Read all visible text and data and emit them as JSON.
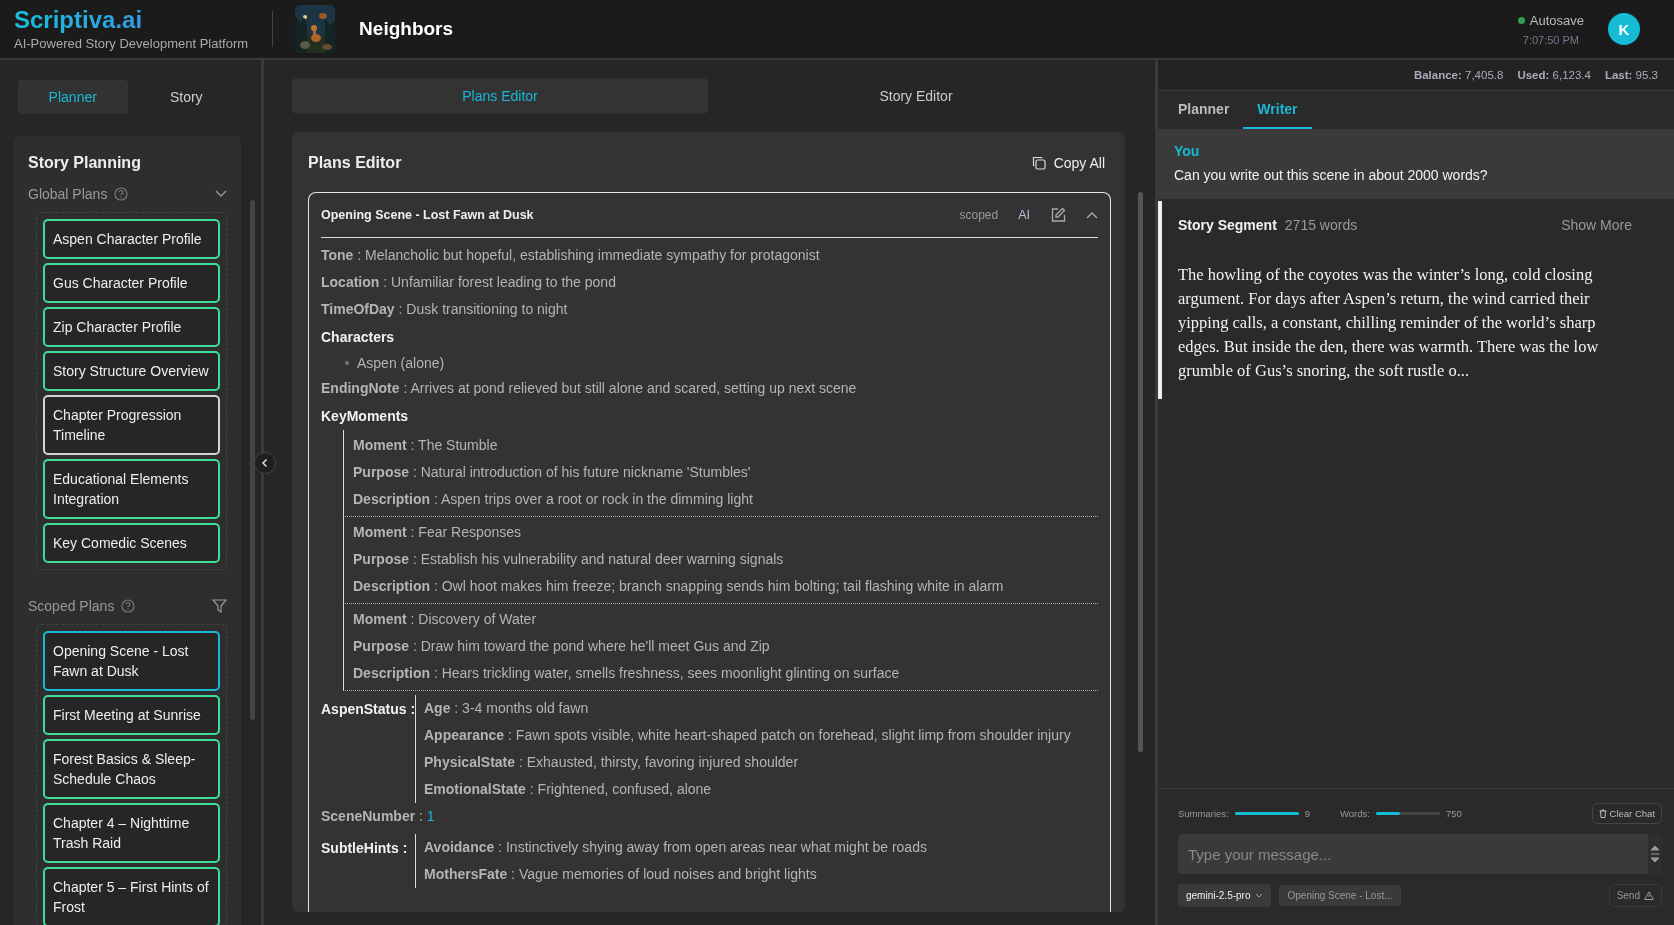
{
  "header": {
    "logo": "Scriptiva.ai",
    "tagline": "AI-Powered Story Development Platform",
    "project_title": "Neighbors",
    "autosave": {
      "label": "Autosave",
      "on": true,
      "time": "7:07:50 PM"
    },
    "avatar": "K"
  },
  "sidebar": {
    "tabs": [
      {
        "label": "Planner",
        "selected": true
      },
      {
        "label": "Story",
        "selected": false
      }
    ],
    "title": "Story Planning",
    "sections": [
      {
        "title": "Global Plans",
        "kind": "chevron",
        "items": [
          {
            "label": "Aspen Character Profile",
            "color": "#3ddc97",
            "selected": false
          },
          {
            "label": "Gus Character Profile",
            "color": "#3ddc97",
            "selected": false
          },
          {
            "label": "Zip Character Profile",
            "color": "#3ddc97",
            "selected": false
          },
          {
            "label": "Story Structure Overview",
            "color": "#3ddc97",
            "selected": false
          },
          {
            "label": "Chapter Progression Timeline",
            "color": "#d4d4d4",
            "selected": false
          },
          {
            "label": "Educational Elements Integration",
            "color": "#3ddc97",
            "selected": false
          },
          {
            "label": "Key Comedic Scenes",
            "color": "#3ddc97",
            "selected": false
          }
        ]
      },
      {
        "title": "Scoped Plans",
        "kind": "filter",
        "items": [
          {
            "label": "Opening Scene - Lost Fawn at Dusk",
            "selected": true
          },
          {
            "label": "First Meeting at Sunrise",
            "color": "#3ddc97",
            "selected": false
          },
          {
            "label": "Forest Basics & Sleep-Schedule Chaos",
            "color": "#3ddc97",
            "selected": false
          },
          {
            "label": "Chapter 4 – Nighttime Trash Raid",
            "color": "#3ddc97",
            "selected": false
          },
          {
            "label": "Chapter 5 – First Hints of Frost",
            "color": "#3ddc97",
            "selected": false
          }
        ]
      }
    ]
  },
  "editor": {
    "tabs": [
      {
        "label": "Plans Editor",
        "selected": true
      },
      {
        "label": "Story Editor",
        "selected": false
      }
    ],
    "title": "Plans Editor",
    "copy_button": "Copy All",
    "plan": {
      "title": "Opening Scene - Lost Fawn at Dusk",
      "scope": "scoped",
      "ai": "AI",
      "expanded": true,
      "fields": [
        {
          "kind": "text",
          "text": "**Tone** : Melancholic but hopeful, establishing immediate sympathy for protagonist"
        },
        {
          "kind": "text",
          "text": "**Location** : Unfamiliar forest leading to the pond"
        },
        {
          "kind": "text",
          "text": "**TimeOfDay** : Dusk transitioning to night"
        },
        {
          "kind": "list",
          "key": "Characters",
          "items": [
            "Aspen (alone)"
          ]
        },
        {
          "kind": "text",
          "text": "**EndingNote** : Arrives at pond relieved but still alone and scared, setting up next scene"
        },
        {
          "kind": "groups",
          "key": "KeyMoments",
          "groups": [
            [
              "**Moment** : The Stumble",
              "**Purpose** : Natural introduction of his future nickname 'Stumbles'",
              "**Description** : Aspen trips over a root or rock in the dimming light"
            ],
            [
              "**Moment** : Fear Responses",
              "**Purpose** : Establish his vulnerability and natural deer warning signals",
              "**Description** : Owl hoot makes him freeze; branch snapping sends him bolting; tail flashing white in alarm"
            ],
            [
              "**Moment** : Discovery of Water",
              "**Purpose** : Draw him toward the pond where he'll meet Gus and Zip",
              "**Description** : Hears trickling water, smells freshness, sees moonlight glinting on surface"
            ]
          ]
        },
        {
          "kind": "object",
          "key": "AspenStatus :",
          "fields": [
            "**Age** : 3-4 months old fawn",
            "**Appearance** : Fawn spots visible, white heart-shaped patch on forehead, slight limp from shoulder injury",
            "**PhysicalState** : Exhausted, thirsty, favoring injured shoulder",
            "**EmotionalState** : Frightened, confused, alone"
          ]
        },
        {
          "kind": "number",
          "key": "**SceneNumber** :",
          "value": "1"
        },
        {
          "kind": "object",
          "key": "SubtleHints :",
          "fields": [
            "**Avoidance** : Instinctively shying away from open areas near what might be roads",
            "**MothersFate** : Vague memories of loud noises and bright lights"
          ]
        }
      ]
    }
  },
  "chat": {
    "stats": [
      {
        "label": "Balance:",
        "value": "7,405.8"
      },
      {
        "label": "Used:",
        "value": "6,123.4"
      },
      {
        "label": "Last:",
        "value": "95.3"
      }
    ],
    "tabs": [
      {
        "label": "Planner",
        "selected": false
      },
      {
        "label": "Writer",
        "selected": true
      }
    ],
    "messages": [
      {
        "kind": "user",
        "author": "You",
        "text": "Can you write out this scene in about 2000 words?"
      },
      {
        "kind": "segment",
        "title": "Story Segment",
        "count": "2715 words",
        "toggle": "Show More",
        "text": "The howling of the coyotes was the winter’s long, cold closing argument. For days after Aspen’s return, the wind carried their yipping calls, a constant, chilling reminder of the world’s sharp edges. But inside the den, there was warmth. There was the low grumble of Gus’s snoring, the soft rustle o..."
      }
    ],
    "meters": [
      {
        "label": "Summaries:",
        "level": 1.0,
        "value": "9"
      },
      {
        "label": "Words:",
        "level": 0.37,
        "value": "750"
      }
    ],
    "clear_button": "Clear Chat",
    "input": {
      "placeholder": "Type your message..."
    },
    "model": "gemini-2.5-pro",
    "context_chip": "Opening Scene - Lost...",
    "send_button": "Send"
  }
}
